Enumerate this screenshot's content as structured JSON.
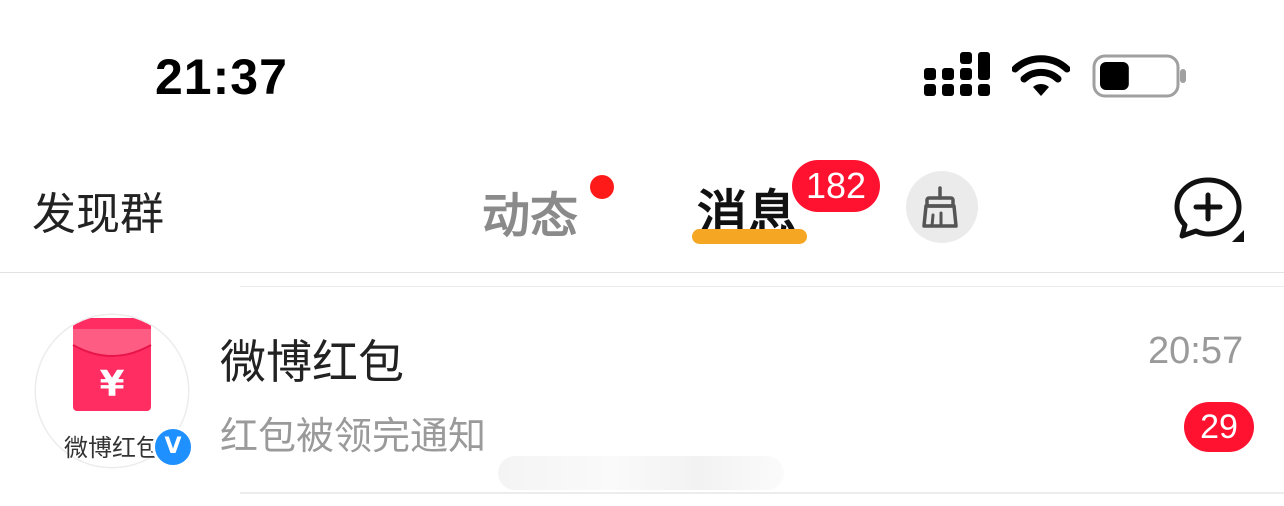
{
  "status_bar": {
    "time": "21:37",
    "signal_icon": "cellular-signal-icon",
    "wifi_icon": "wifi-icon",
    "battery_icon": "battery-icon",
    "battery_level": 0.4
  },
  "header": {
    "left_link": "发现群",
    "tabs": [
      {
        "label": "动态",
        "has_red_dot": true,
        "active": false
      },
      {
        "label": "消息",
        "badge": "182",
        "active": true
      }
    ],
    "clean_icon": "broom-icon",
    "compose_icon": "chat-plus-icon",
    "accent_color": "#f5a623",
    "badge_color": "#ff1230"
  },
  "conversations": [
    {
      "avatar_label": "微博红包",
      "avatar_icon": "red-envelope-icon",
      "verified_icon": "verified-badge-icon",
      "name": "微博红包",
      "preview": "红包被领完通知",
      "time": "20:57",
      "unread": "29"
    }
  ]
}
